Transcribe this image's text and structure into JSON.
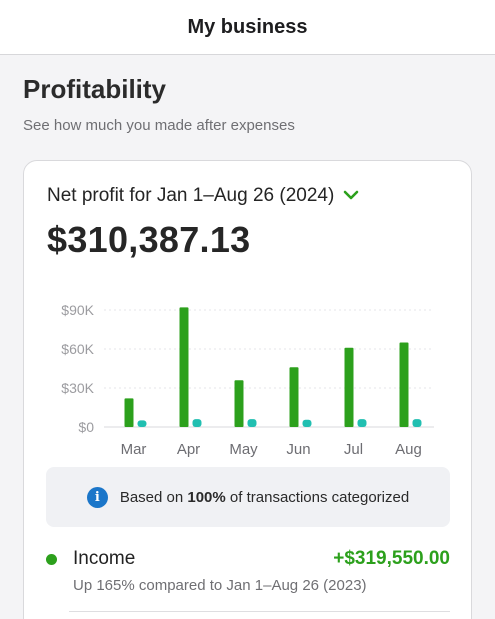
{
  "header": {
    "title": "My business"
  },
  "section": {
    "title": "Profitability",
    "subtitle": "See how much you made after expenses"
  },
  "card": {
    "period_label": "Net profit for Jan 1–Aug 26 (2024)",
    "amount": "$310,387.13",
    "info": {
      "prefix": "Based on ",
      "percent": "100%",
      "suffix": " of transactions categorized"
    },
    "income": {
      "label": "Income",
      "value": "+$319,550.00",
      "comparison": "Up 165% compared to Jan 1–Aug 26 (2023)"
    }
  },
  "colors": {
    "income": "#2ca01c",
    "expenses": "#21bfb1",
    "info": "#1b76c9"
  },
  "icons": {
    "period_toggle": "chevron-down-icon",
    "info": "info-icon"
  },
  "chart_data": {
    "type": "bar",
    "categories": [
      "Mar",
      "Apr",
      "May",
      "Jun",
      "Jul",
      "Aug"
    ],
    "series": [
      {
        "values": [
          22000,
          92000,
          36000,
          46000,
          61000,
          65000
        ]
      },
      {
        "values": [
          2000,
          3000,
          3000,
          2500,
          3000,
          3000
        ]
      }
    ],
    "yticks": [
      "$0",
      "$30K",
      "$60K",
      "$90K"
    ],
    "ylim": [
      0,
      90000
    ],
    "grid": true
  }
}
